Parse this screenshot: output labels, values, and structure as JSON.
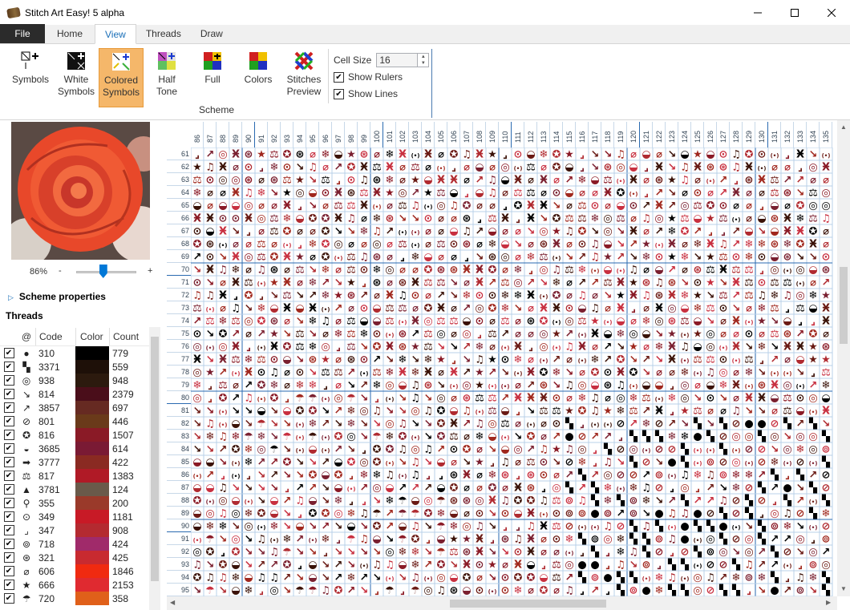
{
  "window": {
    "title": "Stitch Art Easy! 5 alpha"
  },
  "tabs": [
    {
      "label": "File",
      "key": "file"
    },
    {
      "label": "Home",
      "key": "home"
    },
    {
      "label": "View",
      "key": "view"
    },
    {
      "label": "Threads",
      "key": "threads"
    },
    {
      "label": "Draw",
      "key": "draw"
    }
  ],
  "ribbon": {
    "buttons": [
      {
        "label": "Symbols",
        "icon": "symbols-icon"
      },
      {
        "label": "White Symbols",
        "icon": "white-symbols-icon"
      },
      {
        "label": "Colored Symbols",
        "icon": "colored-symbols-icon",
        "selected": true
      },
      {
        "label": "Half Tone",
        "icon": "half-tone-icon"
      },
      {
        "label": "Full",
        "icon": "full-icon"
      },
      {
        "label": "Colors",
        "icon": "colors-icon"
      },
      {
        "label": "Stitches Preview",
        "icon": "stitches-preview-icon"
      }
    ],
    "group_label": "Scheme",
    "cell_size_label": "Cell Size",
    "cell_size_value": "16",
    "show_rulers_label": "Show Rulers",
    "show_rulers": true,
    "show_lines_label": "Show Lines",
    "show_lines": true
  },
  "left": {
    "zoom_percent": "86%",
    "zoom_minus": "-",
    "zoom_plus": "+",
    "zoom_fraction": 0.45,
    "scheme_properties_label": "Scheme properties",
    "threads_title": "Threads",
    "columns": {
      "sym": "@",
      "code": "Code",
      "color": "Color",
      "count": "Count"
    },
    "threads": [
      {
        "sym": "●",
        "code": "310",
        "color": "#000000",
        "count": "779"
      },
      {
        "sym": "▚",
        "code": "3371",
        "color": "#1e1008",
        "count": "559"
      },
      {
        "sym": "◎",
        "code": "938",
        "color": "#2c1a0e",
        "count": "948"
      },
      {
        "sym": "↘",
        "code": "814",
        "color": "#4a0e1a",
        "count": "2379"
      },
      {
        "sym": "↗",
        "code": "3857",
        "color": "#662a22",
        "count": "697"
      },
      {
        "sym": "⊘",
        "code": "801",
        "color": "#6a3a1a",
        "count": "446"
      },
      {
        "sym": "✪",
        "code": "816",
        "color": "#8a1a26",
        "count": "1507"
      },
      {
        "sym": "◒",
        "code": "3685",
        "color": "#7a1a34",
        "count": "614"
      },
      {
        "sym": "➡",
        "code": "3777",
        "color": "#8a2a22",
        "count": "422"
      },
      {
        "sym": "⚖",
        "code": "817",
        "color": "#b01a26",
        "count": "1383"
      },
      {
        "sym": "▲",
        "code": "3781",
        "color": "#6a5a4a",
        "count": "124"
      },
      {
        "sym": "⚲",
        "code": "355",
        "color": "#9a3a2a",
        "count": "200"
      },
      {
        "sym": "⊙",
        "code": "349",
        "color": "#c81a26",
        "count": "1181"
      },
      {
        "sym": "⌟",
        "code": "347",
        "color": "#b42a30",
        "count": "908"
      },
      {
        "sym": "⊚",
        "code": "718",
        "color": "#a02a6a",
        "count": "424"
      },
      {
        "sym": "⊛",
        "code": "321",
        "color": "#c82a30",
        "count": "425"
      },
      {
        "sym": "⌀",
        "code": "606",
        "color": "#f02a10",
        "count": "1846"
      },
      {
        "sym": "★",
        "code": "666",
        "color": "#e02a30",
        "count": "2153"
      },
      {
        "sym": "☂",
        "code": "720",
        "color": "#e0601a",
        "count": "358"
      }
    ]
  },
  "grid": {
    "col_start": 86,
    "col_end": 135,
    "row_start": 61,
    "row_end": 95
  }
}
